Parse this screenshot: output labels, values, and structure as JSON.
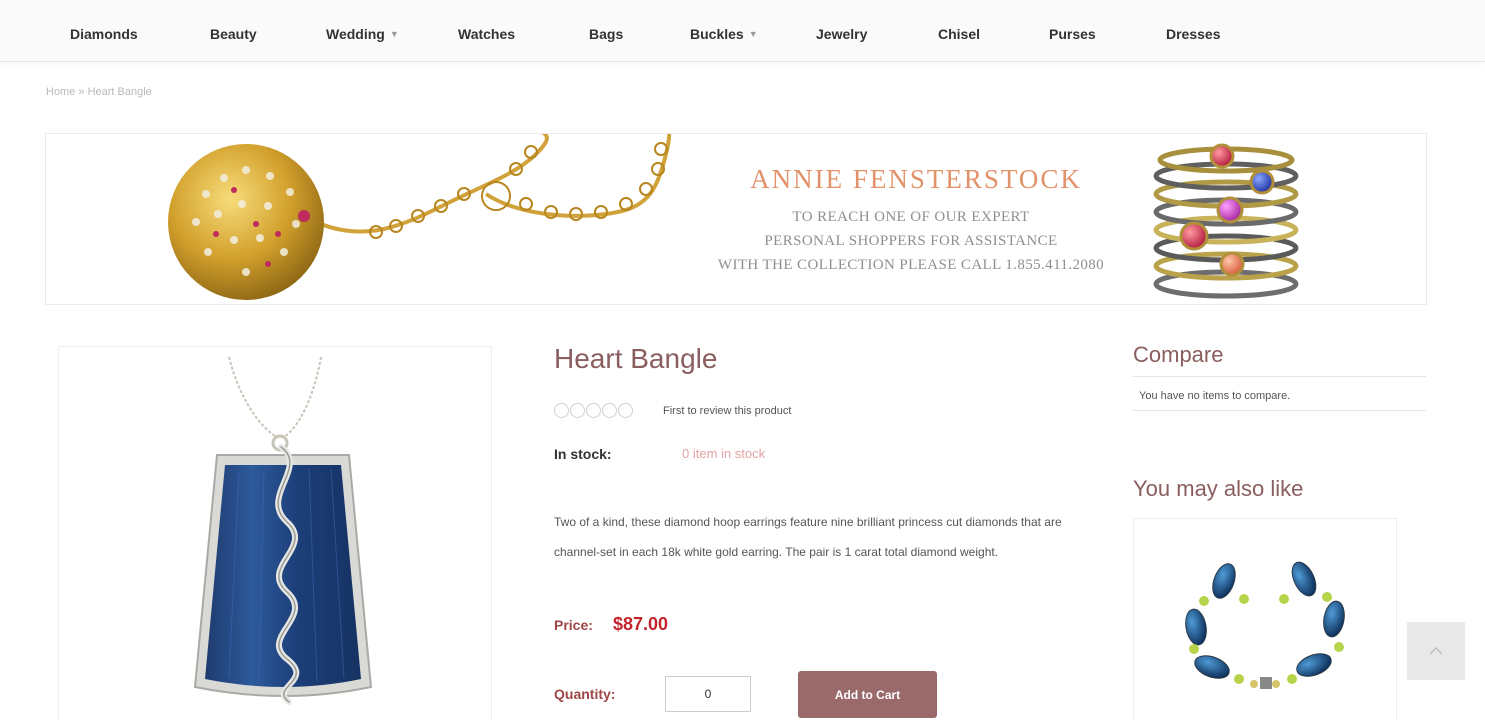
{
  "nav": {
    "items": [
      {
        "label": "Diamonds",
        "has_dropdown": false
      },
      {
        "label": "Beauty",
        "has_dropdown": false
      },
      {
        "label": "Wedding",
        "has_dropdown": true
      },
      {
        "label": "Watches",
        "has_dropdown": false
      },
      {
        "label": "Bags",
        "has_dropdown": false
      },
      {
        "label": "Buckles",
        "has_dropdown": true
      },
      {
        "label": "Jewelry",
        "has_dropdown": false
      },
      {
        "label": "Chisel",
        "has_dropdown": false
      },
      {
        "label": "Purses",
        "has_dropdown": false
      },
      {
        "label": "Dresses",
        "has_dropdown": false
      }
    ],
    "dropdown_icon": "chevron-down-icon"
  },
  "breadcrumb": {
    "home": "Home",
    "separator": "»",
    "current": "Heart Bangle"
  },
  "banner": {
    "brand": "ANNIE FENSTERSTOCK",
    "line1": "TO REACH ONE OF OUR EXPERT",
    "line2": "PERSONAL SHOPPERS FOR ASSISTANCE",
    "line3": "WITH THE COLLECTION PLEASE CALL 1.855.411.2080"
  },
  "product": {
    "title": "Heart Bangle",
    "rating": 0,
    "review_link": "First to review this product",
    "stock_label": "In stock:",
    "stock_value": "0 item in stock",
    "description": "Two of a kind, these diamond hoop earrings feature nine brilliant princess cut diamonds that are channel-set in each 18k white gold earring. The pair is 1 carat total diamond weight.",
    "price_label": "Price:",
    "price": "$87.00",
    "quantity_label": "Quantity:",
    "quantity_value": "0",
    "add_to_cart": "Add to Cart"
  },
  "sidebar": {
    "compare_title": "Compare",
    "compare_text": "You have no items to compare.",
    "also_like_title": "You may also like"
  },
  "colors": {
    "accent": "#9a6a6a",
    "heading": "#8a5e5f",
    "price": "#c3242d",
    "stock": "#e3a4a4",
    "brand": "#e2926a"
  },
  "back_to_top_icon": "chevron-up-icon"
}
